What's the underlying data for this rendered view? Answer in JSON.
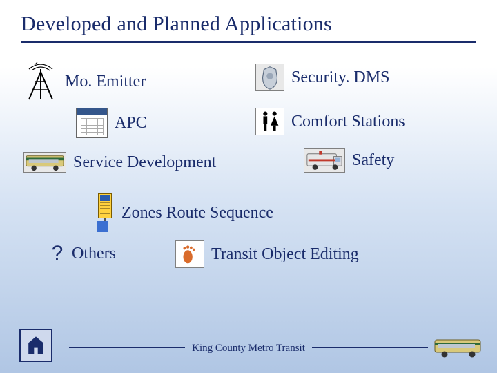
{
  "title": "Developed and Planned Applications",
  "items": {
    "mo_emitter": "Mo. Emitter",
    "apc": "APC",
    "service_dev": "Service Development",
    "security_dms": "Security. DMS",
    "comfort": "Comfort Stations",
    "safety": "Safety",
    "zones": "Zones Route Sequence",
    "others": "Others",
    "toe": "Transit Object Editing"
  },
  "icons": {
    "tower": "radio-tower-icon",
    "apc": "tally-sheet-icon",
    "bus": "bus-icon",
    "badge": "police-badge-icon",
    "restroom": "restroom-icon",
    "van": "ambulance-van-icon",
    "sign": "bus-stop-sign-icon",
    "question": "?",
    "footprint": "footprint-icon"
  },
  "footer": {
    "org": "King County Metro Transit"
  }
}
